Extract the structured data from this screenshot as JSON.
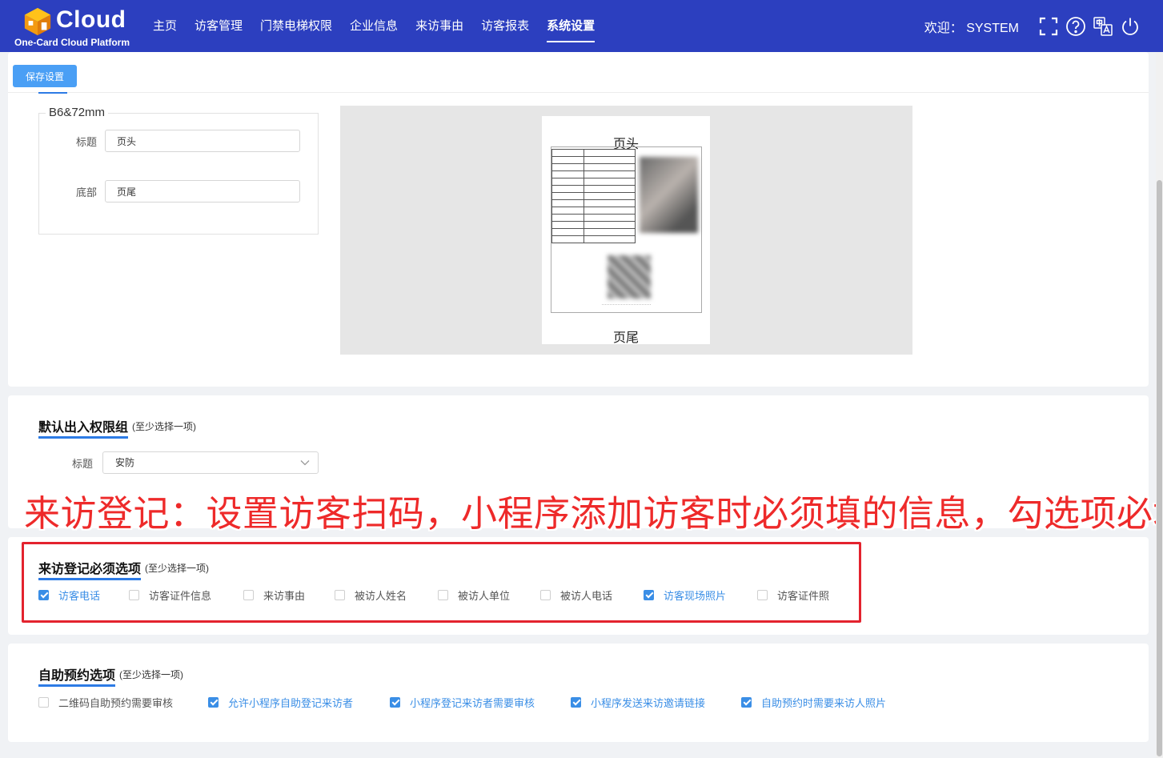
{
  "header": {
    "logo_text": "Cloud",
    "logo_sub": "One-Card Cloud Platform",
    "nav": [
      "主页",
      "访客管理",
      "门禁电梯权限",
      "企业信息",
      "来访事由",
      "访客报表",
      "系统设置"
    ],
    "active_nav": "系统设置",
    "welcome": "欢迎： SYSTEM",
    "brand_color": "#2c3fbf"
  },
  "print_settings": {
    "save_label": "保存设置",
    "paper_size": "B6&72mm",
    "title_label": "标题",
    "title_value": "页头",
    "footer_label": "底部",
    "footer_value": "页尾",
    "preview_header": "页头",
    "preview_footer": "页尾"
  },
  "default_group": {
    "title": "默认出入权限组",
    "hint": "(至少选择一项)",
    "label": "标题",
    "selected": "安防"
  },
  "annotation": "来访登记：设置访客扫码，小程序添加访客时必须填的信息，勾选项必填",
  "required_fields": {
    "title": "来访登记必须选项",
    "hint": "(至少选择一项)",
    "items": [
      {
        "label": "访客电话",
        "checked": true
      },
      {
        "label": "访客证件信息",
        "checked": false
      },
      {
        "label": "来访事由",
        "checked": false
      },
      {
        "label": "被访人姓名",
        "checked": false
      },
      {
        "label": "被访人单位",
        "checked": false
      },
      {
        "label": "被访人电话",
        "checked": false
      },
      {
        "label": "访客现场照片",
        "checked": true
      },
      {
        "label": "访客证件照",
        "checked": false
      }
    ]
  },
  "self_booking": {
    "title": "自助预约选项",
    "hint": "(至少选择一项)",
    "items": [
      {
        "label": "二维码自助预约需要审核",
        "checked": false
      },
      {
        "label": "允许小程序自助登记来访者",
        "checked": true
      },
      {
        "label": "小程序登记来访者需要审核",
        "checked": true
      },
      {
        "label": "小程序发送来访邀请链接",
        "checked": true
      },
      {
        "label": "自助预约时需要来访人照片",
        "checked": true
      }
    ]
  },
  "colors": {
    "accent": "#3a8ee6",
    "annotation_red": "#ee2a2a"
  }
}
